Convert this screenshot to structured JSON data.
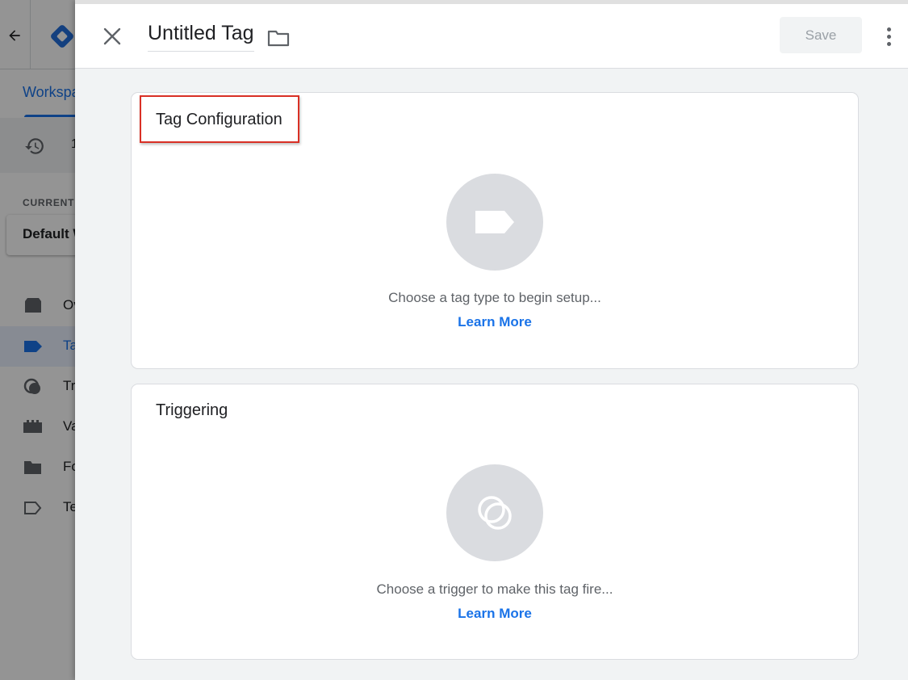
{
  "background": {
    "workspace_tab": "Workspace",
    "history_text": "1",
    "current_workspace_label": "CURRENT WORKSPACE",
    "current_workspace_value": "Default Workspace",
    "nav": [
      {
        "label": "Overview",
        "icon": "overview-icon"
      },
      {
        "label": "Tags",
        "icon": "tag-icon",
        "active": true
      },
      {
        "label": "Triggers",
        "icon": "trigger-icon"
      },
      {
        "label": "Variables",
        "icon": "variables-icon"
      },
      {
        "label": "Folders",
        "icon": "folder-icon"
      },
      {
        "label": "Templates",
        "icon": "template-icon"
      }
    ]
  },
  "panel": {
    "title": "Untitled Tag",
    "save_label": "Save"
  },
  "tag_configuration": {
    "title": "Tag Configuration",
    "hint": "Choose a tag type to begin setup...",
    "learn_more": "Learn More"
  },
  "triggering": {
    "title": "Triggering",
    "hint": "Choose a trigger to make this tag fire...",
    "learn_more": "Learn More"
  },
  "colors": {
    "accent": "#1a73e8",
    "highlight": "#d93025",
    "placeholder_circle": "#dadce0"
  }
}
